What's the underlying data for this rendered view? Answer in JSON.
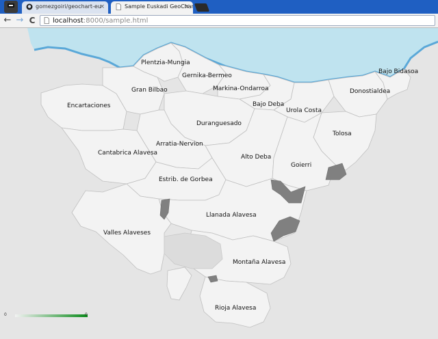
{
  "browser": {
    "tabs": [
      {
        "title": "gomezgoiri/geochart-eu",
        "active": false,
        "close": "×"
      },
      {
        "title": "Sample Euskadi GeoChart",
        "active": true,
        "close": "×"
      }
    ],
    "address_bar": {
      "host": "localhost",
      "rest": ":8000/sample.html"
    },
    "nav": {
      "back": "←",
      "forward": "→",
      "reload": "C"
    }
  },
  "legend": {
    "min": "0",
    "max": "0"
  },
  "colors": {
    "region_fill": "#f3f3f3",
    "region_border": "#bfbfbf",
    "highlight_fill": "#808080",
    "sea": "#bfe3ef",
    "sea_edge": "#5aa8d8",
    "legend_low": "#f2f2f2",
    "legend_high": "#0a8a1a"
  },
  "regions": [
    {
      "label": "Plentzia-Mungia"
    },
    {
      "label": "Gernika-Bermeo"
    },
    {
      "label": "Bajo Bidasoa"
    },
    {
      "label": "Gran Bilbao"
    },
    {
      "label": "Markina-Ondarroa"
    },
    {
      "label": "Donostialdea"
    },
    {
      "label": "Encartaciones"
    },
    {
      "label": "Bajo Deba"
    },
    {
      "label": "Urola Costa"
    },
    {
      "label": "Duranguesado"
    },
    {
      "label": "Tolosa"
    },
    {
      "label": "Arratia-Nervion"
    },
    {
      "label": "Cantabrica Alavesa"
    },
    {
      "label": "Alto Deba"
    },
    {
      "label": "Goierri"
    },
    {
      "label": "Estrib. de Gorbea"
    },
    {
      "label": "Llanada Alavesa"
    },
    {
      "label": "Valles Alaveses"
    },
    {
      "label": "Montaña Alavesa"
    },
    {
      "label": "Rioja Alavesa"
    }
  ]
}
